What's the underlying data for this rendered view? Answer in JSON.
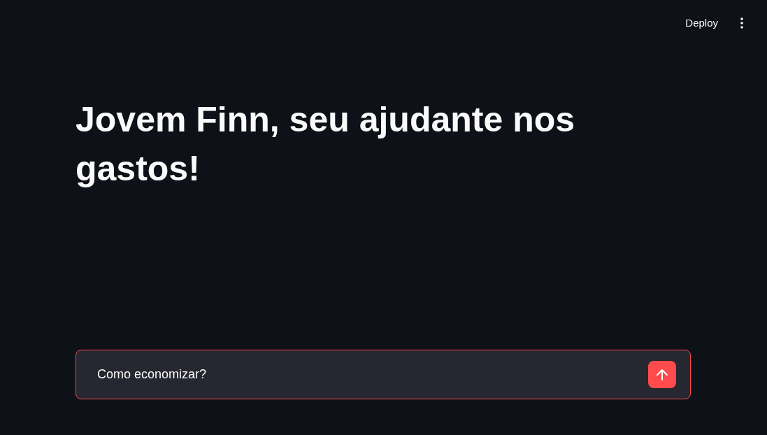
{
  "header": {
    "deploy_button": "Deploy"
  },
  "title": "Jovem Finn, seu ajudante nos gastos!",
  "chat_input": {
    "value": "Como economizar?",
    "focused": true
  }
}
